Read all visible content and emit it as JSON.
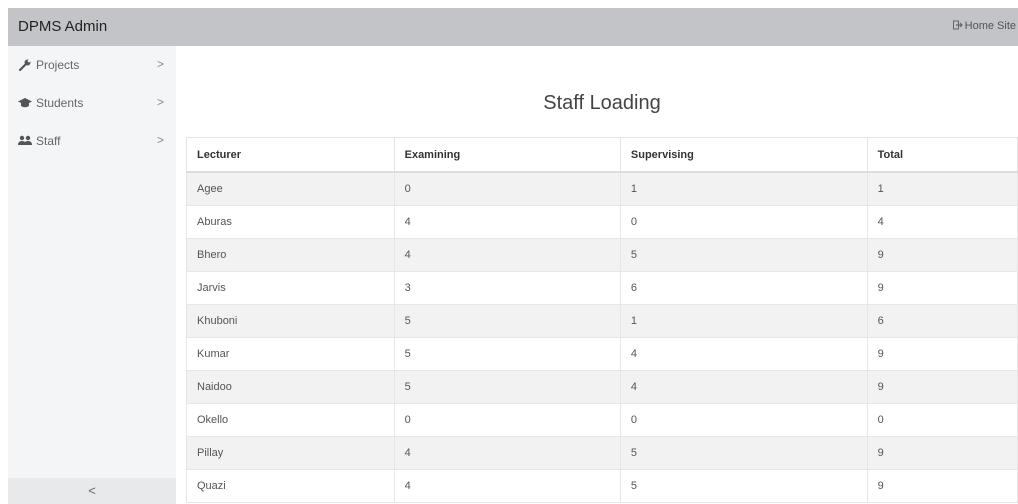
{
  "app": {
    "title": "DPMS Admin",
    "home_link": "Home Site"
  },
  "sidebar": {
    "items": [
      {
        "label": "Projects",
        "icon": "wrench-icon"
      },
      {
        "label": "Students",
        "icon": "graduation-cap-icon"
      },
      {
        "label": "Staff",
        "icon": "users-icon"
      }
    ],
    "chevron": ">",
    "collapse": "<"
  },
  "page": {
    "title": "Staff Loading"
  },
  "table": {
    "headers": [
      "Lecturer",
      "Examining",
      "Supervising",
      "Total"
    ],
    "rows": [
      [
        "Agee",
        "0",
        "1",
        "1"
      ],
      [
        "Aburas",
        "4",
        "0",
        "4"
      ],
      [
        "Bhero",
        "4",
        "5",
        "9"
      ],
      [
        "Jarvis",
        "3",
        "6",
        "9"
      ],
      [
        "Khuboni",
        "5",
        "1",
        "6"
      ],
      [
        "Kumar",
        "5",
        "4",
        "9"
      ],
      [
        "Naidoo",
        "5",
        "4",
        "9"
      ],
      [
        "Okello",
        "0",
        "0",
        "0"
      ],
      [
        "Pillay",
        "4",
        "5",
        "9"
      ],
      [
        "Quazi",
        "4",
        "5",
        "9"
      ]
    ]
  }
}
